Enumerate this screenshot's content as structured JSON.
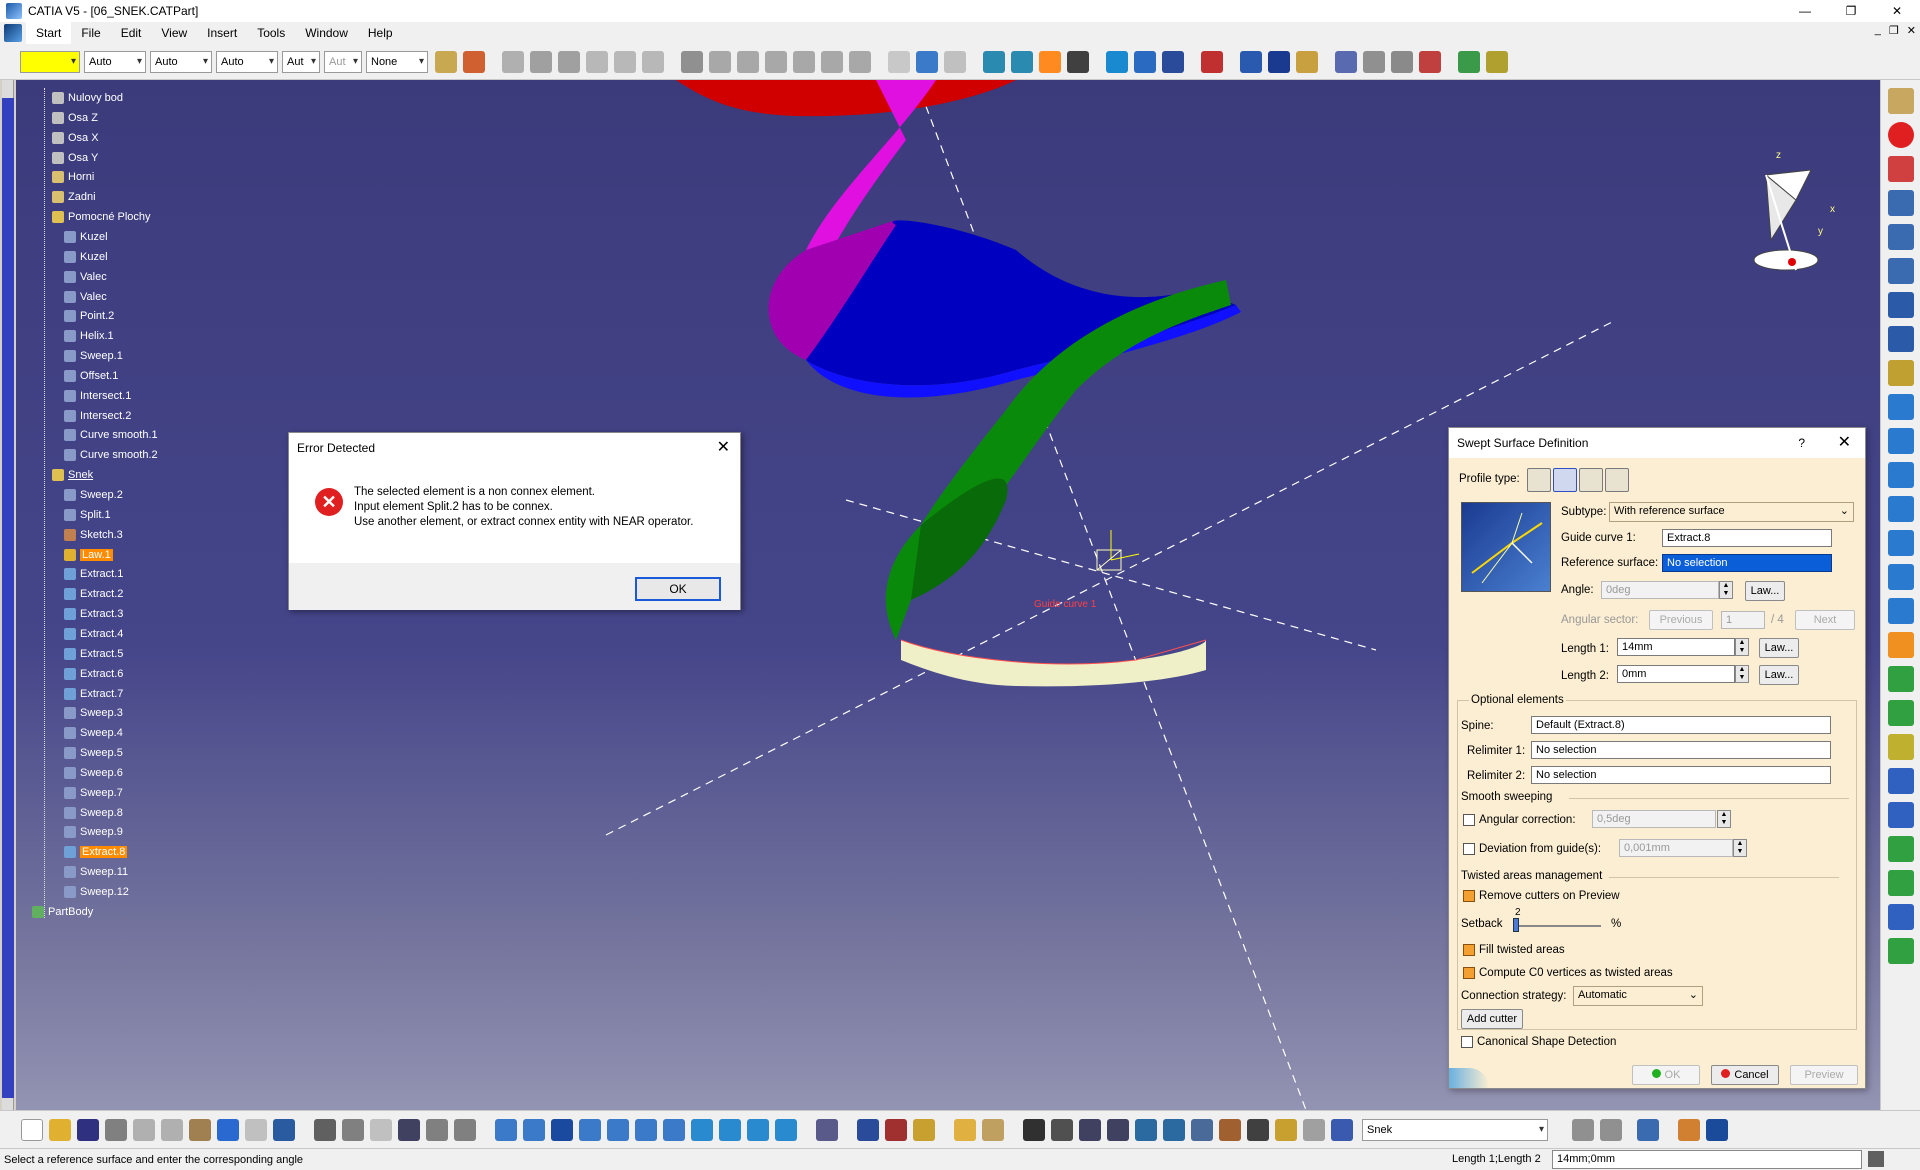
{
  "window": {
    "title": "CATIA V5 - [06_SNEK.CATPart]"
  },
  "menus": [
    "Start",
    "File",
    "Edit",
    "View",
    "Insert",
    "Tools",
    "Window",
    "Help"
  ],
  "toolbar": {
    "color_value": "",
    "line_type": "Auto",
    "thickness": "Auto",
    "layer_weight": "Auto",
    "style1": "Aut",
    "style2": "Aut",
    "layer": "None"
  },
  "tree": {
    "items": [
      {
        "label": "Nulovy bod",
        "level": 1,
        "icon": "point-icon"
      },
      {
        "label": "Osa Z",
        "level": 1,
        "icon": "axis-icon"
      },
      {
        "label": "Osa X",
        "level": 1,
        "icon": "axis-icon"
      },
      {
        "label": "Osa Y",
        "level": 1,
        "icon": "axis-icon"
      },
      {
        "label": "Horni",
        "level": 1,
        "icon": "plane-icon"
      },
      {
        "label": "Zadni",
        "level": 1,
        "icon": "plane-icon"
      },
      {
        "label": "Pomocné Plochy",
        "level": 1,
        "icon": "geoset-icon"
      },
      {
        "label": "Kuzel",
        "level": 2,
        "icon": "surface-icon"
      },
      {
        "label": "Kuzel",
        "level": 2,
        "icon": "surface-icon"
      },
      {
        "label": "Valec",
        "level": 2,
        "icon": "surface-icon"
      },
      {
        "label": "Valec",
        "level": 2,
        "icon": "surface-icon"
      },
      {
        "label": "Point.2",
        "level": 2,
        "icon": "surface-icon"
      },
      {
        "label": "Helix.1",
        "level": 2,
        "icon": "surface-icon"
      },
      {
        "label": "Sweep.1",
        "level": 2,
        "icon": "surface-icon"
      },
      {
        "label": "Offset.1",
        "level": 2,
        "icon": "surface-icon"
      },
      {
        "label": "Intersect.1",
        "level": 2,
        "icon": "surface-icon"
      },
      {
        "label": "Intersect.2",
        "level": 2,
        "icon": "surface-icon"
      },
      {
        "label": "Curve smooth.1",
        "level": 2,
        "icon": "surface-icon"
      },
      {
        "label": "Curve smooth.2",
        "level": 2,
        "icon": "surface-icon"
      },
      {
        "label": "Snek",
        "level": 1,
        "icon": "geoset-icon"
      },
      {
        "label": "Sweep.2",
        "level": 2,
        "icon": "surface-icon"
      },
      {
        "label": "Split.1",
        "level": 2,
        "icon": "surface-icon"
      },
      {
        "label": "Sketch.3",
        "level": 2,
        "icon": "sketch-icon"
      },
      {
        "label": "Law.1",
        "level": 2,
        "icon": "law-icon",
        "highlight": "orange"
      },
      {
        "label": "Extract.1",
        "level": 2,
        "icon": "extract-icon"
      },
      {
        "label": "Extract.2",
        "level": 2,
        "icon": "extract-icon"
      },
      {
        "label": "Extract.3",
        "level": 2,
        "icon": "extract-icon"
      },
      {
        "label": "Extract.4",
        "level": 2,
        "icon": "extract-icon"
      },
      {
        "label": "Extract.5",
        "level": 2,
        "icon": "extract-icon"
      },
      {
        "label": "Extract.6",
        "level": 2,
        "icon": "extract-icon"
      },
      {
        "label": "Extract.7",
        "level": 2,
        "icon": "extract-icon"
      },
      {
        "label": "Sweep.3",
        "level": 2,
        "icon": "surface-icon"
      },
      {
        "label": "Sweep.4",
        "level": 2,
        "icon": "surface-icon"
      },
      {
        "label": "Sweep.5",
        "level": 2,
        "icon": "surface-icon"
      },
      {
        "label": "Sweep.6",
        "level": 2,
        "icon": "surface-icon"
      },
      {
        "label": "Sweep.7",
        "level": 2,
        "icon": "surface-icon"
      },
      {
        "label": "Sweep.8",
        "level": 2,
        "icon": "surface-icon"
      },
      {
        "label": "Sweep.9",
        "level": 2,
        "icon": "surface-icon"
      },
      {
        "label": "Extract.8",
        "level": 2,
        "icon": "extract-icon",
        "highlight": "orange"
      },
      {
        "label": "Sweep.11",
        "level": 2,
        "icon": "surface-icon"
      },
      {
        "label": "Sweep.12",
        "level": 2,
        "icon": "surface-icon"
      },
      {
        "label": "PartBody",
        "level": 0,
        "icon": "partbody-icon"
      }
    ]
  },
  "compass": {
    "x": "x",
    "y": "y",
    "z": "z"
  },
  "error_dialog": {
    "title": "Error Detected",
    "lines": [
      "The selected element is a non connex element.",
      "Input element Split.2 has to be connex.",
      "Use another element, or extract connex entity with NEAR operator."
    ],
    "ok_label": "OK"
  },
  "sweep_dialog": {
    "title": "Swept Surface Definition",
    "help": "?",
    "profile_type_label": "Profile type:",
    "subtype_label": "Subtype:",
    "subtype_value": "With reference surface",
    "guide_curve_label": "Guide curve 1:",
    "guide_curve_value": "Extract.8",
    "ref_surface_label": "Reference surface:",
    "ref_surface_value": "No selection",
    "angle_label": "Angle:",
    "angle_value": "0deg",
    "law_label": "Law...",
    "angular_sector_label": "Angular sector:",
    "previous_label": "Previous",
    "sector_value": "1",
    "sector_total": "/ 4",
    "next_label": "Next",
    "length1_label": "Length 1:",
    "length1_value": "14mm",
    "length2_label": "Length 2:",
    "length2_value": "0mm",
    "optional_label": "Optional elements",
    "spine_label": "Spine:",
    "spine_value": "Default (Extract.8)",
    "relimiter1_label": "Relimiter 1:",
    "relimiter1_value": "No selection",
    "relimiter2_label": "Relimiter 2:",
    "relimiter2_value": "No selection",
    "smooth_label": "Smooth sweeping",
    "angular_corr_label": "Angular correction:",
    "angular_corr_value": "0,5deg",
    "deviation_label": "Deviation from guide(s):",
    "deviation_value": "0,001mm",
    "twisted_label": "Twisted areas management",
    "remove_cutters_label": "Remove cutters on Preview",
    "setback_label": "Setback",
    "setback_value": "2",
    "setback_unit": "%",
    "fill_twisted_label": "Fill twisted areas",
    "compute_c0_label": "Compute C0 vertices as twisted areas",
    "connection_label": "Connection strategy:",
    "connection_value": "Automatic",
    "add_cutter_label": "Add cutter",
    "canonical_label": "Canonical Shape Detection",
    "ok_label": "OK",
    "cancel_label": "Cancel",
    "preview_label": "Preview"
  },
  "viewport_labels": {
    "guide_tag": "Guide curve 1"
  },
  "bottom_toolbar": {
    "current_set": "Snek"
  },
  "status": {
    "message": "Select a reference surface and enter the corresponding angle",
    "length_label": "Length 1;Length 2",
    "length_value": "14mm;0mm"
  }
}
